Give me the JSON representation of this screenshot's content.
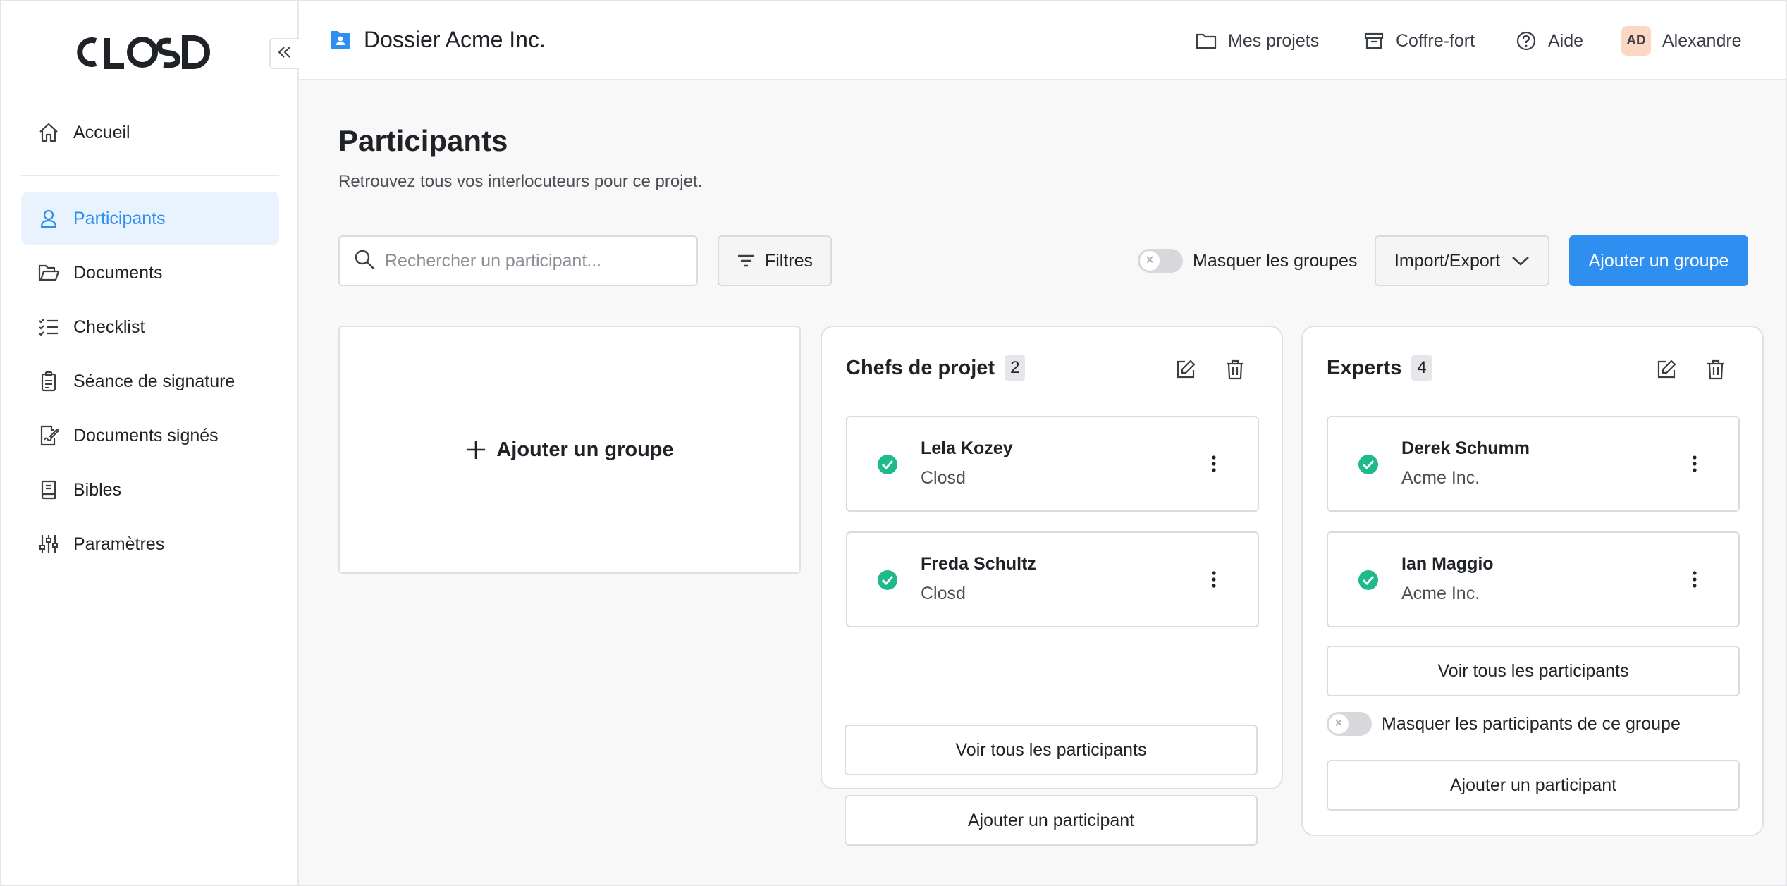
{
  "brand": {
    "logo_text": "CLOSD"
  },
  "colors": {
    "accent": "#2f8ff0",
    "success": "#1fba8a",
    "avatar_bg": "#fcd7c4"
  },
  "sidebar": {
    "items": [
      {
        "label": "Accueil",
        "icon": "home-icon"
      },
      {
        "label": "Participants",
        "icon": "user-icon",
        "active": true
      },
      {
        "label": "Documents",
        "icon": "folder-open-icon"
      },
      {
        "label": "Checklist",
        "icon": "checklist-icon"
      },
      {
        "label": "Séance de signature",
        "icon": "clipboard-icon"
      },
      {
        "label": "Documents signés",
        "icon": "signed-document-icon"
      },
      {
        "label": "Bibles",
        "icon": "book-icon"
      },
      {
        "label": "Paramètres",
        "icon": "sliders-icon"
      }
    ]
  },
  "header": {
    "dossier_title": "Dossier Acme Inc.",
    "links": {
      "projects": "Mes projets",
      "vault": "Coffre-fort",
      "help": "Aide"
    },
    "user": {
      "initials": "AD",
      "name": "Alexandre"
    }
  },
  "page": {
    "title": "Participants",
    "subtitle": "Retrouvez tous vos interlocuteurs pour ce projet."
  },
  "toolbar": {
    "search_placeholder": "Rechercher un participant...",
    "filters_label": "Filtres",
    "hide_groups_label": "Masquer les groupes",
    "hide_groups_on": false,
    "import_export_label": "Import/Export",
    "add_group_label": "Ajouter un groupe"
  },
  "add_group_card": {
    "label": "Ajouter un groupe"
  },
  "groups": [
    {
      "name": "Chefs de projet",
      "count": "2",
      "participants": [
        {
          "name": "Lela Kozey",
          "org": "Closd"
        },
        {
          "name": "Freda Schultz",
          "org": "Closd"
        }
      ],
      "view_all_label": "Voir tous les participants",
      "add_participant_label": "Ajouter un participant"
    },
    {
      "name": "Experts",
      "count": "4",
      "participants": [
        {
          "name": "Derek Schumm",
          "org": "Acme Inc."
        },
        {
          "name": "Ian Maggio",
          "org": "Acme Inc."
        }
      ],
      "view_all_label": "Voir tous les participants",
      "hide_participants_label": "Masquer les participants de ce groupe",
      "hide_participants_on": false,
      "add_participant_label": "Ajouter un participant"
    }
  ]
}
